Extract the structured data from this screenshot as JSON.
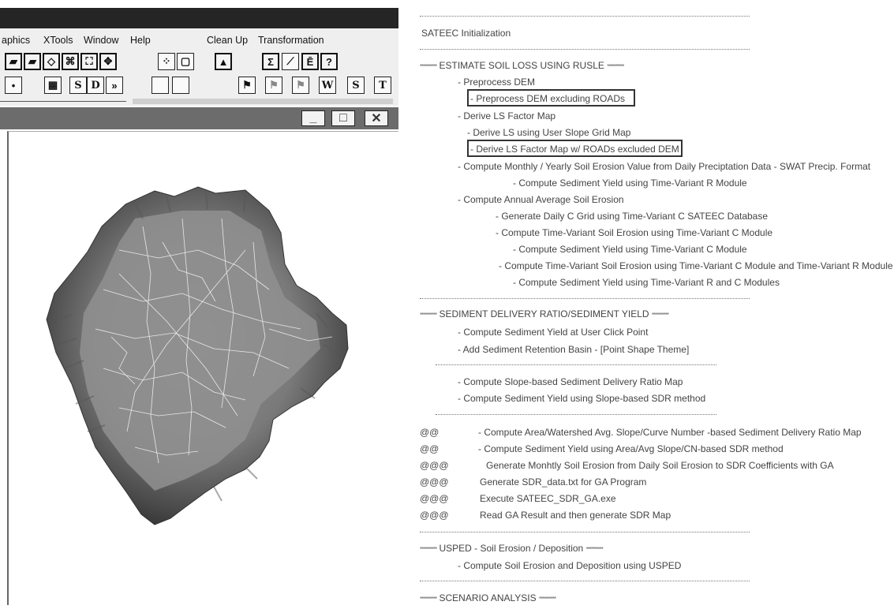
{
  "menubar": {
    "items": [
      "aphics",
      "XTools",
      "Window",
      "Help",
      "Clean Up",
      "Transformation"
    ]
  },
  "toolbar2": {
    "s1": "S",
    "d": "D",
    "chevrons": "»",
    "w": "W",
    "s2": "S",
    "t": "T"
  },
  "view_window": {
    "minimize": "_",
    "maximize": "□",
    "close": "✕"
  },
  "menu_list": {
    "init": "SATEEC Initialization",
    "rusle_header": "ESTIMATE SOIL LOSS USING RUSLE",
    "stars": "**********",
    "items": {
      "preprocess_dem": "- Preprocess DEM",
      "preprocess_dem_roads": "- Preprocess DEM excluding ROADs",
      "derive_ls": "- Derive LS Factor Map",
      "derive_ls_user": "- Derive LS using User Slope Grid Map",
      "derive_ls_roads": "- Derive LS Factor Map w/ ROADs excluded DEM",
      "compute_monthly": "- Compute Monthly / Yearly Soil Erosion Value from Daily Preciptation Data - SWAT Precip. Format",
      "sed_yield_r": "- Compute Sediment Yield using Time-Variant R Module",
      "annual_avg": "- Compute Annual Average Soil Erosion",
      "daily_c": "- Generate Daily C Grid using Time-Variant C SATEEC Database",
      "tv_soil_c": "- Compute Time-Variant Soil Erosion using Time-Variant C Module",
      "sed_yield_c": "- Compute Sediment Yield using Time-Variant C Module",
      "tv_soil_cr": "- Compute Time-Variant Soil Erosion using Time-Variant C Module and Time-Variant R Module",
      "sed_yield_rc": "- Compute Sediment Yield using Time-Variant R and C Modules"
    },
    "sdr_header": "SEDIMENT DELIVERY RATIO/SEDIMENT YIELD",
    "sdr_items": {
      "click_point": "- Compute Sediment Yield at User Click Point",
      "retention": "- Add Sediment Retention Basin - [Point Shape Theme]",
      "slope_sdr_map": "- Compute Slope-based Sediment Delivery Ratio Map",
      "slope_sdr_yield": "- Compute Sediment Yield using Slope-based SDR method"
    },
    "ga_rows": [
      {
        "mark": "@@",
        "text": "- Compute Area/Watershed Avg. Slope/Curve Number -based Sediment Delivery Ratio Map"
      },
      {
        "mark": "@@",
        "text": "- Compute Sediment Yield using  Area/Avg Slope/CN-based SDR method"
      },
      {
        "mark": "@@@",
        "text": "Generate Monhtly  Soil Erosion from Daily Soil Erosion to SDR Coefficients with GA"
      },
      {
        "mark": "@@@",
        "text": "Generate SDR_data.txt for GA Program"
      },
      {
        "mark": "@@@",
        "text": "Execute SATEEC_SDR_GA.exe"
      },
      {
        "mark": "@@@",
        "text": "Read GA Result and then generate SDR Map"
      }
    ],
    "usped_header": "USPED - Soil Erosion / Deposition",
    "usped_item": "- Compute Soil Erosion and Deposition using USPED",
    "scenario_header": "SCENARIO ANALYSIS"
  }
}
